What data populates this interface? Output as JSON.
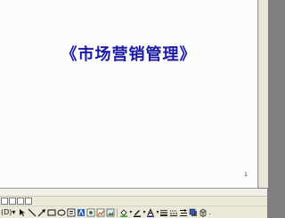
{
  "slide": {
    "title": "《市场营销管理》",
    "page_number": "1"
  },
  "toolbar_drawing": {
    "draw_label": "(D)",
    "dropdown_glyph": "▾",
    "trailing": "."
  },
  "icons": [
    "normal-view-icon",
    "outline-view-icon",
    "slide-sorter-icon",
    "slideshow-icon",
    "select-arrow-icon",
    "line-icon",
    "arrow-icon",
    "rectangle-icon",
    "oval-icon",
    "textbox-icon",
    "wordart-icon",
    "diagram-icon",
    "clipart-icon",
    "insert-picture-icon",
    "fill-color-icon",
    "line-color-icon",
    "font-color-icon",
    "line-style-icon",
    "dash-style-icon",
    "arrow-style-icon",
    "shadow-icon",
    "3d-icon"
  ],
  "colors": {
    "title": "#1a1aa6",
    "slide_background": "#fcfcfc",
    "workspace": "#7f7f7f",
    "toolbar": "#ece9d8"
  }
}
